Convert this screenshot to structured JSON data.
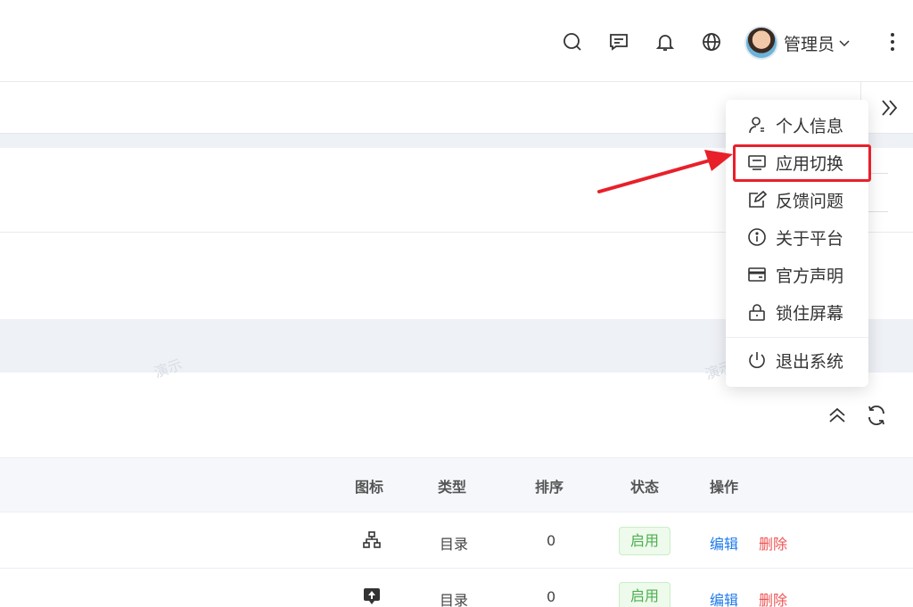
{
  "header": {
    "user_name": "管理员",
    "icons": [
      "search-icon",
      "message-icon",
      "bell-icon",
      "globe-icon"
    ]
  },
  "user_menu": {
    "items": [
      {
        "label": "个人信息",
        "icon": "user-icon"
      },
      {
        "label": "应用切换",
        "icon": "app-switch-icon"
      },
      {
        "label": "反馈问题",
        "icon": "feedback-icon"
      },
      {
        "label": "关于平台",
        "icon": "info-icon"
      },
      {
        "label": "官方声明",
        "icon": "card-icon"
      },
      {
        "label": "锁住屏幕",
        "icon": "lock-icon"
      },
      {
        "label": "退出系统",
        "icon": "power-icon"
      }
    ],
    "highlighted": "应用切换"
  },
  "watermark_text": "演示",
  "table": {
    "columns": [
      "图标",
      "类型",
      "排序",
      "状态",
      "操作"
    ],
    "rows": [
      {
        "icon": "org-chart-icon",
        "type": "目录",
        "order": "0",
        "status": "启用",
        "edit": "编辑",
        "delete": "删除"
      },
      {
        "icon": "upload-icon",
        "type": "目录",
        "order": "0",
        "status": "启用",
        "edit": "编辑",
        "delete": "删除"
      }
    ]
  },
  "colors": {
    "accent": "#1f7aeb",
    "danger": "#f05454",
    "success": "#4caf50",
    "highlight": "#e8202a"
  }
}
